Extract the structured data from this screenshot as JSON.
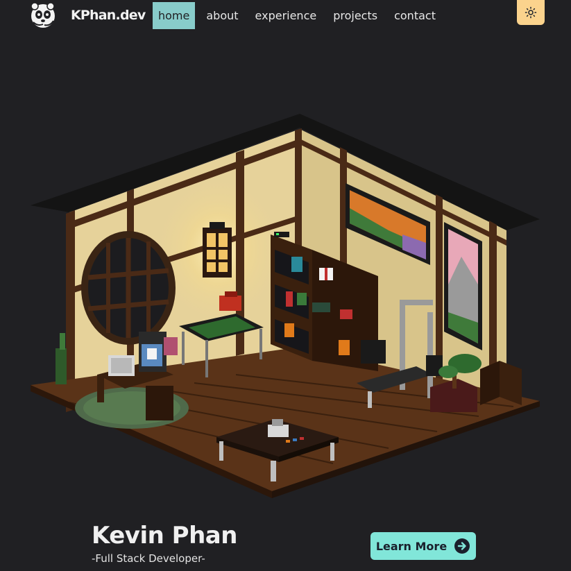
{
  "brand": {
    "name": "KPhan.dev",
    "logo_icon": "panda-logo-icon"
  },
  "nav": {
    "items": [
      {
        "label": "home",
        "active": true
      },
      {
        "label": "about",
        "active": false
      },
      {
        "label": "experience",
        "active": false
      },
      {
        "label": "projects",
        "active": false
      },
      {
        "label": "contact",
        "active": false
      }
    ]
  },
  "theme_toggle": {
    "icon": "sun-icon",
    "color": "#fbd38d"
  },
  "hero": {
    "scene": "voxel-room-illustration",
    "name": "Kevin Phan",
    "role": "-Full Stack Developer-",
    "cta_label": "Learn More",
    "cta_icon": "arrow-right-circle-icon",
    "cta_color": "#81e6d9"
  },
  "colors": {
    "background": "#202023",
    "active_nav": "#88ccca"
  }
}
